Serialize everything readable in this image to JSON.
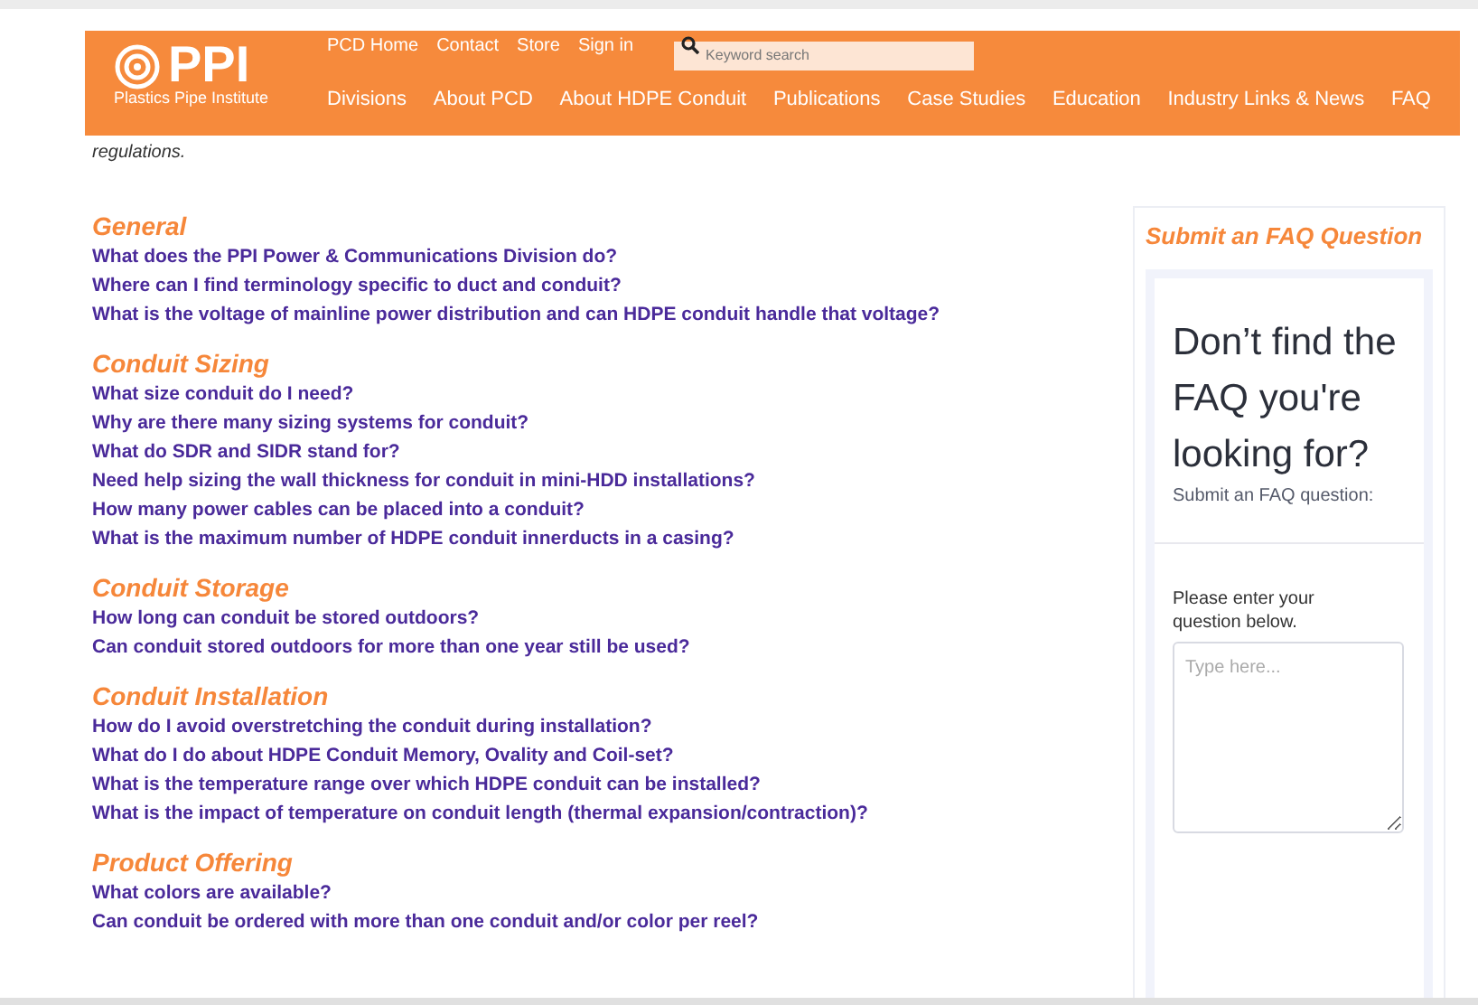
{
  "header": {
    "logo_text": "PPI",
    "logo_subtitle": "Plastics Pipe Institute",
    "top_links": [
      "PCD Home",
      "Contact",
      "Store",
      "Sign in"
    ],
    "search": {
      "placeholder": "Keyword search"
    },
    "nav": [
      "Divisions",
      "About PCD",
      "About HDPE Conduit",
      "Publications",
      "Case Studies",
      "Education",
      "Industry Links & News",
      "FAQ"
    ]
  },
  "intro_tail": "regulations.",
  "sections": [
    {
      "title": "General",
      "questions": [
        "What does the PPI Power & Communications Division do?",
        "Where can I find terminology specific to duct and conduit?",
        "What is the voltage of mainline power distribution and can HDPE conduit handle that voltage?"
      ]
    },
    {
      "title": "Conduit Sizing",
      "questions": [
        "What size conduit do I need?",
        "Why are there many sizing systems for conduit?",
        "What do SDR and SIDR stand for?",
        "Need help sizing the wall thickness for conduit in mini-HDD installations?",
        "How many power cables can be placed into a conduit?",
        "What is the maximum number of HDPE conduit innerducts in a casing?"
      ]
    },
    {
      "title": "Conduit Storage",
      "questions": [
        "How long can conduit be stored outdoors?",
        "Can conduit stored outdoors for more than one year still be used?"
      ]
    },
    {
      "title": "Conduit Installation",
      "questions": [
        "How do I avoid overstretching the conduit during installation?",
        "What do I do about HDPE Conduit Memory, Ovality and Coil-set?",
        "What is the temperature range over which HDPE conduit can be installed?",
        "What is the impact of temperature on conduit length (thermal expansion/contraction)?"
      ]
    },
    {
      "title": "Product Offering",
      "questions": [
        "What colors are available?",
        "Can conduit be ordered with more than one conduit and/or color per reel?"
      ]
    }
  ],
  "sidebar": {
    "title": "Submit an FAQ Question",
    "form_heading": "Don’t find the FAQ you're looking for?",
    "form_subheading": "Submit an FAQ question:",
    "field_label": "Please enter your question below.",
    "field": {
      "placeholder": "Type here..."
    }
  }
}
